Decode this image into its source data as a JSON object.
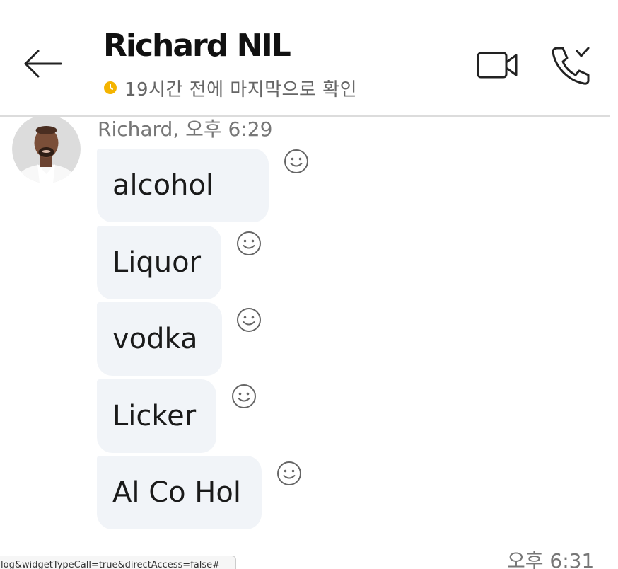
{
  "header": {
    "contact_name": "Richard NIL",
    "status_text": "19시간 전에 마지막으로 확인",
    "status_color": "#f4b400",
    "back_icon": "arrow-left-icon",
    "video_icon": "video-camera-icon",
    "call_icon": "phone-call-icon"
  },
  "conversation": {
    "sender_meta": "Richard, 오후 6:29",
    "messages": [
      {
        "text": "alcohol"
      },
      {
        "text": "Liquor"
      },
      {
        "text": "vodka"
      },
      {
        "text": "Licker"
      },
      {
        "text": "Al Co Hol"
      }
    ],
    "react_icon": "smiley-face-icon",
    "bubble_color": "#f1f4f8"
  },
  "footer": {
    "status_url": "log&widgetTypeCall=true&directAccess=false#",
    "last_time": "오후 6:31"
  }
}
